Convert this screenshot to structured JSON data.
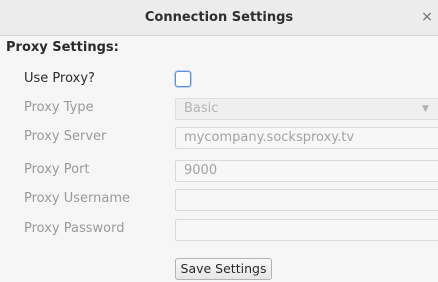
{
  "dialog": {
    "title": "Connection Settings",
    "close_glyph": "×"
  },
  "section": {
    "title": "Proxy Settings:"
  },
  "use_proxy": {
    "label": "Use Proxy?",
    "checked": false
  },
  "proxy_type": {
    "label": "Proxy Type",
    "value": "Basic",
    "icon": "chevron-down-icon"
  },
  "proxy_server": {
    "label": "Proxy Server",
    "value": "mycompany.socksproxy.tv"
  },
  "proxy_port": {
    "label": "Proxy Port",
    "value": "9000"
  },
  "proxy_username": {
    "label": "Proxy Username",
    "value": ""
  },
  "proxy_password": {
    "label": "Proxy Password",
    "value": ""
  },
  "actions": {
    "save_label": "Save Settings"
  },
  "colors": {
    "accent": "#5b8fd6",
    "disabled_text": "#9a9a9a",
    "background": "#f6f6f6"
  }
}
